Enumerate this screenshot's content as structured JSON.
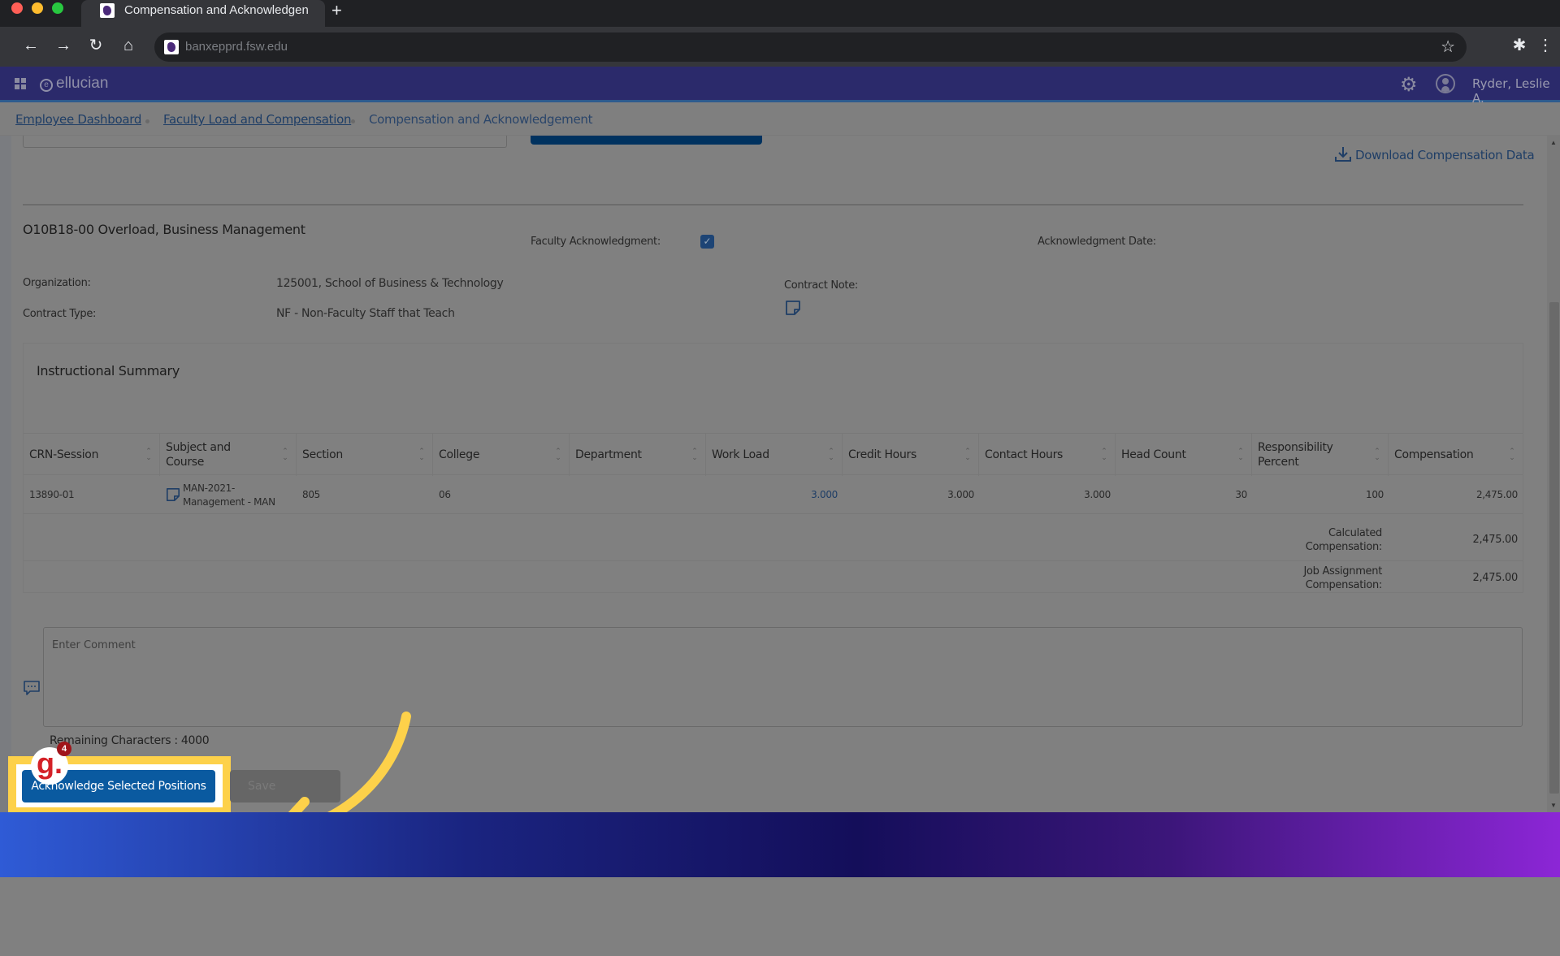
{
  "browser": {
    "tab_title": "Compensation and Acknowledgen",
    "new_tab_label": "+",
    "url": "banxepprd.fsw.edu",
    "traffic_colors": [
      "#ff5f57",
      "#febc2e",
      "#28c840"
    ]
  },
  "app_header": {
    "logo_text": "ellucian",
    "user_name": "Ryder, Leslie A."
  },
  "breadcrumb": {
    "items": [
      "Employee Dashboard",
      "Faculty Load and Compensation"
    ],
    "current": "Compensation and Acknowledgement"
  },
  "actions": {
    "download_label": "Download Compensation Data"
  },
  "position": {
    "heading": "O10B18-00 Overload, Business Management",
    "ack_label": "Faculty Acknowledgment:",
    "ack_checked": true,
    "ack_date_label": "Acknowledgment Date:",
    "ack_date_value": "",
    "organization_label": "Organization:",
    "organization_value": "125001, School of Business & Technology",
    "contract_type_label": "Contract Type:",
    "contract_type_value": "NF - Non-Faculty Staff that Teach",
    "contract_note_label": "Contract Note:"
  },
  "summary": {
    "title": "Instructional Summary",
    "columns": [
      "CRN-Session",
      "Subject and Course",
      "Section",
      "College",
      "Department",
      "Work Load",
      "Credit Hours",
      "Contact Hours",
      "Head Count",
      "Responsibility Percent",
      "Compensation"
    ],
    "rows": [
      {
        "crn_session": "13890-01",
        "subject_course": "MAN-2021-\nManagement - MAN",
        "subject_line1": "MAN-2021-",
        "subject_line2": "Management - MAN",
        "section": "805",
        "college": "06",
        "department": "",
        "work_load": "3.000",
        "credit_hours": "3.000",
        "contact_hours": "3.000",
        "head_count": "30",
        "responsibility_percent": "100",
        "compensation": "2,475.00"
      }
    ],
    "calculated_label_1": "Calculated",
    "calculated_label_2": "Compensation:",
    "calculated_value": "2,475.00",
    "job_assignment_label_1": "Job Assignment",
    "job_assignment_label_2": "Compensation:",
    "job_assignment_value": "2,475.00"
  },
  "comment": {
    "placeholder": "Enter Comment",
    "value": "",
    "remaining_text": "Remaining Characters : 4000"
  },
  "buttons": {
    "acknowledge": "Acknowledge Selected Positions",
    "save": "Save"
  },
  "overlay": {
    "badge_letter": "g.",
    "badge_count": "4",
    "highlight_color": "#fdd14a"
  }
}
